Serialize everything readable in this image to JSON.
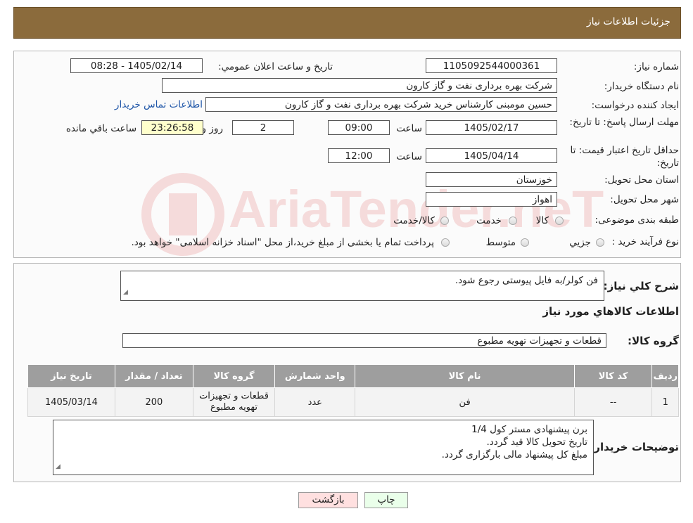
{
  "header": {
    "title": "جزئیات اطلاعات نیاز"
  },
  "form": {
    "need_number_label": "شماره نیاز:",
    "need_number": "1105092544000361",
    "announce_label": "تاریخ و ساعت اعلان عمومي:",
    "announce_value": "1405/02/14 - 08:28",
    "buyer_org_label": "نام دستگاه خریدار:",
    "buyer_org": "شرکت بهره برداری نفت و گاز کارون",
    "creator_label": "ایجاد کننده درخواست:",
    "creator": "حسین مومبنی کارشناس خرید شرکت بهره برداری نفت و گاز کارون",
    "contact_link": "اطلاعات تماس خریدار",
    "deadline_label": "مهلت ارسال پاسخ: تا تاریخ:",
    "deadline_date": "1405/02/17",
    "time_label": "ساعت",
    "deadline_time": "09:00",
    "days_value": "2",
    "days_label": "روز و",
    "remaining_time": "23:26:58",
    "remaining_label": "ساعت باقي مانده",
    "validity_label": "حداقل تاریخ اعتبار قیمت: تا تاریخ:",
    "validity_date": "1405/04/14",
    "validity_time": "12:00",
    "province_label": "استان محل تحویل:",
    "province": "خوزستان",
    "city_label": "شهر محل تحویل:",
    "city": "اهواز",
    "category_label": "طبقه بندی موضوعی:",
    "category_options": [
      "کالا",
      "خدمت",
      "کالا/خدمت"
    ],
    "process_label": "نوع فرآیند خرید :",
    "process_options": [
      "جزیي",
      "متوسط"
    ],
    "process_note": "پرداخت تمام یا بخشی از مبلغ خرید،از محل \"اسناد خزانه اسلامی\" خواهد بود."
  },
  "summary": {
    "description_label": "شرح كلي نیاز:",
    "description": "فن کولر/به فایل پیوستی رجوع شود.",
    "goods_info_title": "اطلاعات کالاهاي مورد نیاز",
    "goods_group_label": "گروه کالا:",
    "goods_group": "قطعات و تجهیزات تهویه مطبوع"
  },
  "table": {
    "headers": [
      "ردیف",
      "کد کالا",
      "نام کالا",
      "واحد شمارش",
      "گروه کالا",
      "تعداد / مقدار",
      "تاریخ نیاز"
    ],
    "rows": [
      [
        "1",
        "--",
        "فن",
        "عدد",
        "قطعات و تجهیزات تهویه مطبوع",
        "200",
        "1405/03/14"
      ]
    ]
  },
  "buyer_notes": {
    "label": "توضیحات خریدار:",
    "lines": [
      "برن پیشنهادی مستر کول 1/4",
      "تاریخ تحویل کالا قید گردد.",
      "مبلغ کل پیشنهاد مالی بارگزاری گردد."
    ]
  },
  "buttons": {
    "print": "چاپ",
    "back": "بازگشت"
  },
  "watermark": "AriaTender.neT"
}
